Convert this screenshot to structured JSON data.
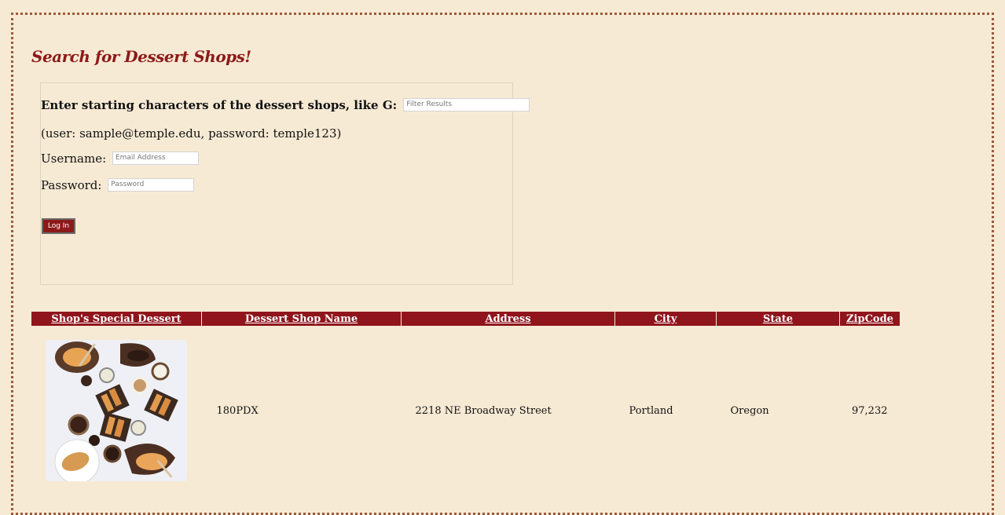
{
  "page": {
    "title": "Search for Dessert Shops!"
  },
  "filter": {
    "label": "Enter starting characters of the dessert shops, like G:",
    "placeholder": "Filter Results"
  },
  "login": {
    "hint": "(user: sample@temple.edu, password: temple123)",
    "username_label": "Username:",
    "username_placeholder": "Email Address",
    "password_label": "Password:",
    "password_placeholder": "Password",
    "button_label": "Log In"
  },
  "table": {
    "headers": [
      "Shop's Special Dessert",
      "Dessert Shop Name",
      "Address",
      "City",
      "State",
      "ZipCode"
    ],
    "rows": [
      {
        "image_icon": "dessert-photo",
        "name": "180PDX",
        "address": "2218 NE Broadway Street",
        "city": "Portland",
        "state": "Oregon",
        "zip": "97,232"
      }
    ]
  },
  "colors": {
    "background": "#f7ead4",
    "accent": "#8f141c",
    "title": "#8c1a1a",
    "frame_border": "#9a5a3c"
  }
}
